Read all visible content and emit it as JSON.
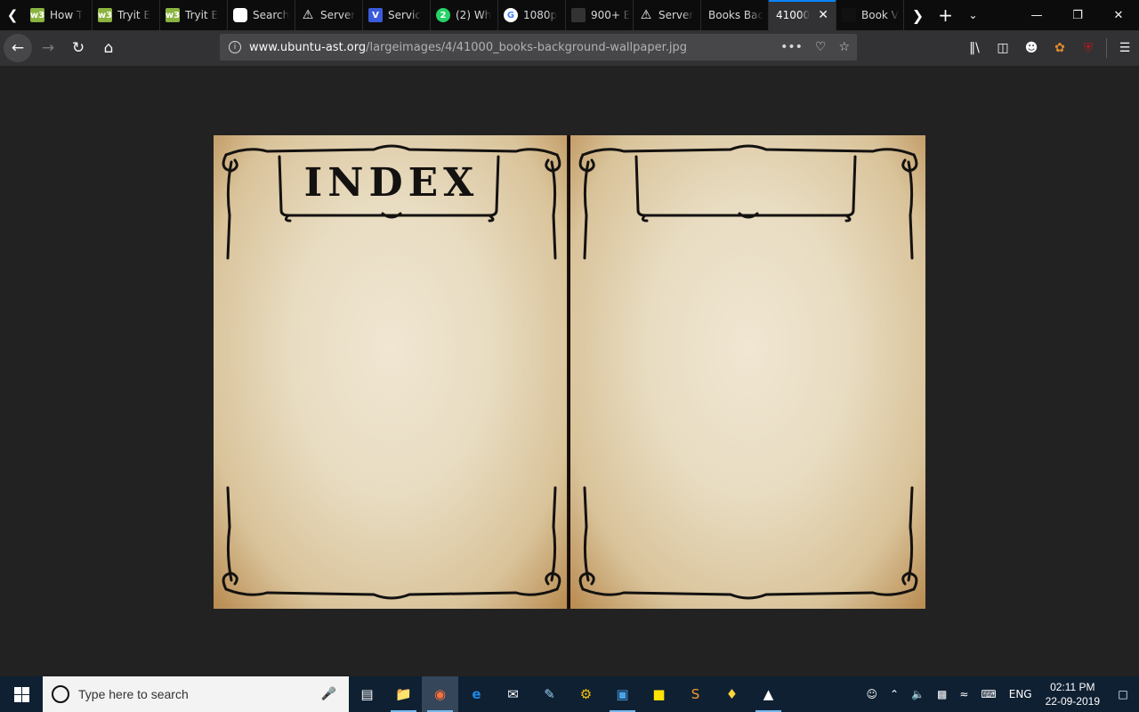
{
  "browser": {
    "tabs": [
      {
        "label": "How T",
        "icon": "w3-green-icon",
        "color": "#8ab33f"
      },
      {
        "label": "Tryit E",
        "icon": "w3-green-icon",
        "color": "#8ab33f"
      },
      {
        "label": "Tryit E",
        "icon": "w3-green-icon",
        "color": "#8ab33f"
      },
      {
        "label": "Search",
        "icon": "shield-icon",
        "color": "#ffffff"
      },
      {
        "label": "Server",
        "icon": "warning-icon",
        "color": "#ffffff"
      },
      {
        "label": "Servic",
        "icon": "v-icon",
        "color": "#3b5bdb"
      },
      {
        "label": "(2) Wh",
        "icon": "whatsapp-icon",
        "color": "#25d366"
      },
      {
        "label": "1080p",
        "icon": "google-icon",
        "color": "#ffffff"
      },
      {
        "label": "900+ E",
        "icon": "dark-icon",
        "color": "#333333"
      },
      {
        "label": "Server",
        "icon": "warning-icon",
        "color": "#ffffff"
      },
      {
        "label": "Books Bac",
        "icon": "",
        "color": ""
      },
      {
        "label": "41000_",
        "icon": "",
        "color": "",
        "active": true
      },
      {
        "label": "Book V",
        "icon": "dark-icon",
        "color": "#111111"
      }
    ],
    "url_host": "www.ubuntu-ast.org",
    "url_path": "/largeimages/4/41000_books-background-wallpaper.jpg"
  },
  "content": {
    "title": "INDEX"
  },
  "taskbar": {
    "search_placeholder": "Type here to search",
    "language": "ENG",
    "time": "02:11 PM",
    "date": "22-09-2019"
  },
  "colors": {
    "tabstrip": "#0c0c0d",
    "toolbar": "#323234",
    "accent": "#0a84ff",
    "taskbar": "#0f2033",
    "parchment": "#e8dcc1"
  }
}
